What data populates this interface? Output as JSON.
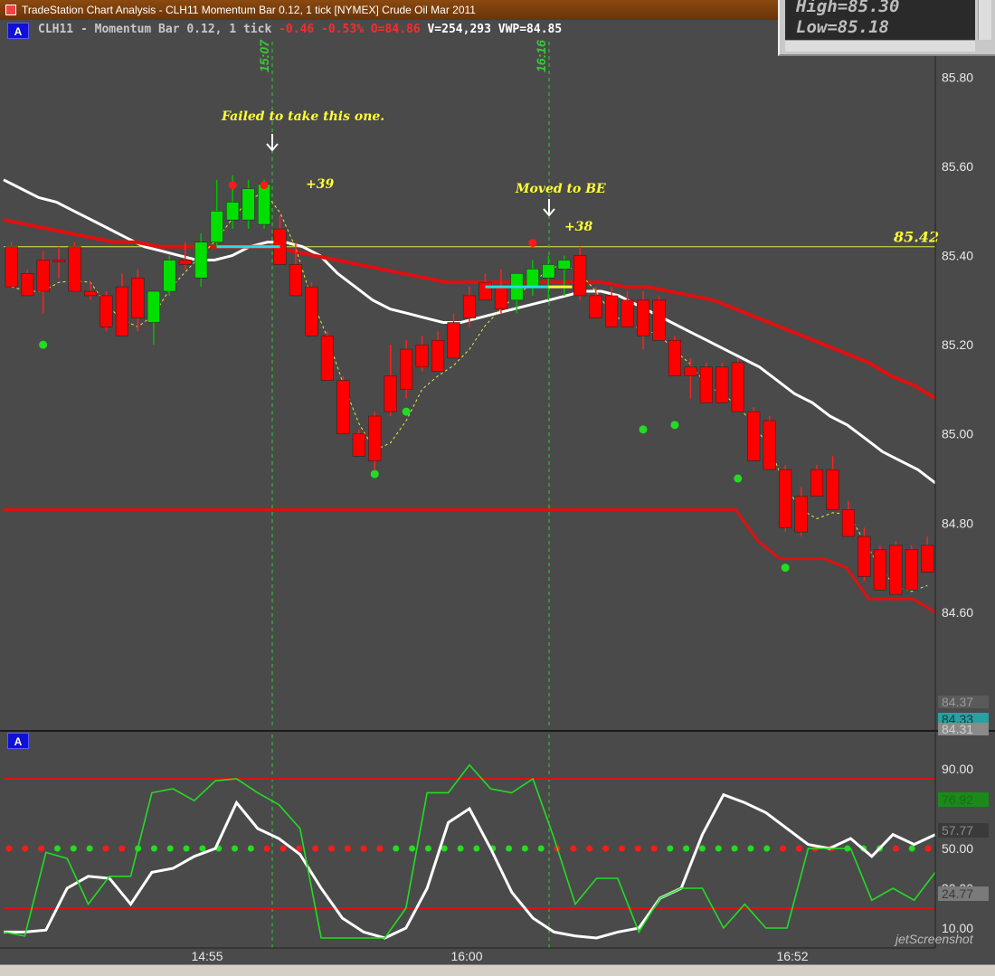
{
  "window": {
    "title": "TradeStation Chart Analysis - CLH11 Momentum Bar 0.12, 1 tick [NYMEX] Crude Oil Mar 2011"
  },
  "info_box": {
    "high": "High=85.30",
    "low": "Low=85.18"
  },
  "price_header": {
    "badge": "A",
    "symbol": "CLH11 - Momentum Bar 0.12, 1 tick",
    "change": "-0.46 -0.53% O=84.86",
    "volume": "V=254,293 VWP=84.85"
  },
  "indicator_header": {
    "badge": "A"
  },
  "price_axis": {
    "ticks": [
      "85.80",
      "85.60",
      "85.40",
      "85.20",
      "85.00",
      "84.80",
      "84.60",
      "84.40"
    ],
    "current_label": "85.42",
    "side_labels": [
      {
        "text": "84.37",
        "bg": "#5a5a5a",
        "fg": "#9a9a9a"
      },
      {
        "text": "84.33",
        "bg": "#2aa0a0",
        "fg": "#1a3a3a"
      },
      {
        "text": "84.31",
        "bg": "#8a8a8a",
        "fg": "#d0d0d0"
      }
    ]
  },
  "indicator_axis": {
    "ticks": [
      "90.00",
      "50.00",
      "30.00",
      "10.00"
    ],
    "side_labels": [
      {
        "text": "76.92",
        "bg": "#1a8a1a",
        "fg": "#1a6a1a"
      },
      {
        "text": "57.77",
        "bg": "#3a3a3a",
        "fg": "#8a8a8a"
      },
      {
        "text": "24.77",
        "bg": "#7a7a7a",
        "fg": "#3a3a3a"
      }
    ]
  },
  "time_axis": [
    "14:55",
    "16:00",
    "16:52"
  ],
  "vertical_markers": [
    "15:07",
    "16:16"
  ],
  "annotations": {
    "failed": "Failed to take this one.",
    "plus39": "+39",
    "moved": "Moved to BE",
    "plus38": "+38"
  },
  "colors": {
    "background": "#4a4a4a",
    "up_bar": "#00e000",
    "down_bar": "#ff0000",
    "ma_fast": "#ffffff",
    "ma_slow": "#e01010",
    "annotation": "#ffff33"
  },
  "chart_data": [
    {
      "type": "candlestick",
      "x_axis_labels": [
        "14:55",
        "16:00",
        "16:52"
      ],
      "ylim": [
        84.34,
        85.88
      ],
      "reference_line": 85.42,
      "candles": [
        {
          "o": 85.42,
          "h": 85.43,
          "l": 85.33,
          "c": 85.33,
          "up": false
        },
        {
          "o": 85.36,
          "h": 85.37,
          "l": 85.31,
          "c": 85.31,
          "up": false
        },
        {
          "o": 85.39,
          "h": 85.41,
          "l": 85.27,
          "c": 85.32,
          "up": false
        },
        {
          "o": 85.39,
          "h": 85.42,
          "l": 85.35,
          "c": 85.39,
          "up": false
        },
        {
          "o": 85.42,
          "h": 85.43,
          "l": 85.32,
          "c": 85.32,
          "up": false
        },
        {
          "o": 85.32,
          "h": 85.34,
          "l": 85.3,
          "c": 85.31,
          "up": false
        },
        {
          "o": 85.31,
          "h": 85.32,
          "l": 85.23,
          "c": 85.24,
          "up": false
        },
        {
          "o": 85.33,
          "h": 85.36,
          "l": 85.22,
          "c": 85.22,
          "up": false
        },
        {
          "o": 85.35,
          "h": 85.37,
          "l": 85.23,
          "c": 85.26,
          "up": false
        },
        {
          "o": 85.25,
          "h": 85.32,
          "l": 85.2,
          "c": 85.32,
          "up": true
        },
        {
          "o": 85.32,
          "h": 85.4,
          "l": 85.31,
          "c": 85.39,
          "up": true
        },
        {
          "o": 85.39,
          "h": 85.43,
          "l": 85.37,
          "c": 85.38,
          "up": false
        },
        {
          "o": 85.35,
          "h": 85.45,
          "l": 85.33,
          "c": 85.43,
          "up": true
        },
        {
          "o": 85.43,
          "h": 85.57,
          "l": 85.42,
          "c": 85.5,
          "up": true
        },
        {
          "o": 85.48,
          "h": 85.58,
          "l": 85.46,
          "c": 85.52,
          "up": true
        },
        {
          "o": 85.48,
          "h": 85.57,
          "l": 85.46,
          "c": 85.55,
          "up": true
        },
        {
          "o": 85.47,
          "h": 85.57,
          "l": 85.46,
          "c": 85.56,
          "up": true
        },
        {
          "o": 85.46,
          "h": 85.49,
          "l": 85.38,
          "c": 85.38,
          "up": false
        },
        {
          "o": 85.38,
          "h": 85.43,
          "l": 85.31,
          "c": 85.31,
          "up": false
        },
        {
          "o": 85.33,
          "h": 85.34,
          "l": 85.22,
          "c": 85.22,
          "up": false
        },
        {
          "o": 85.22,
          "h": 85.23,
          "l": 85.12,
          "c": 85.12,
          "up": false
        },
        {
          "o": 85.12,
          "h": 85.13,
          "l": 85.0,
          "c": 85.0,
          "up": false
        },
        {
          "o": 85.0,
          "h": 85.01,
          "l": 84.95,
          "c": 84.95,
          "up": false
        },
        {
          "o": 85.04,
          "h": 85.05,
          "l": 84.92,
          "c": 84.94,
          "up": false
        },
        {
          "o": 85.13,
          "h": 85.2,
          "l": 85.04,
          "c": 85.05,
          "up": false
        },
        {
          "o": 85.19,
          "h": 85.21,
          "l": 85.08,
          "c": 85.1,
          "up": false
        },
        {
          "o": 85.2,
          "h": 85.22,
          "l": 85.14,
          "c": 85.15,
          "up": false
        },
        {
          "o": 85.21,
          "h": 85.23,
          "l": 85.14,
          "c": 85.14,
          "up": false
        },
        {
          "o": 85.25,
          "h": 85.27,
          "l": 85.17,
          "c": 85.17,
          "up": false
        },
        {
          "o": 85.31,
          "h": 85.33,
          "l": 85.24,
          "c": 85.26,
          "up": false
        },
        {
          "o": 85.34,
          "h": 85.36,
          "l": 85.3,
          "c": 85.3,
          "up": false
        },
        {
          "o": 85.33,
          "h": 85.37,
          "l": 85.27,
          "c": 85.28,
          "up": false
        },
        {
          "o": 85.3,
          "h": 85.36,
          "l": 85.27,
          "c": 85.36,
          "up": true
        },
        {
          "o": 85.33,
          "h": 85.39,
          "l": 85.31,
          "c": 85.37,
          "up": true
        },
        {
          "o": 85.35,
          "h": 85.4,
          "l": 85.3,
          "c": 85.38,
          "up": true
        },
        {
          "o": 85.37,
          "h": 85.4,
          "l": 85.31,
          "c": 85.39,
          "up": true
        },
        {
          "o": 85.4,
          "h": 85.42,
          "l": 85.3,
          "c": 85.31,
          "up": false
        },
        {
          "o": 85.31,
          "h": 85.33,
          "l": 85.26,
          "c": 85.26,
          "up": false
        },
        {
          "o": 85.31,
          "h": 85.33,
          "l": 85.24,
          "c": 85.24,
          "up": false
        },
        {
          "o": 85.3,
          "h": 85.32,
          "l": 85.24,
          "c": 85.24,
          "up": false
        },
        {
          "o": 85.3,
          "h": 85.32,
          "l": 85.19,
          "c": 85.22,
          "up": false
        },
        {
          "o": 85.3,
          "h": 85.31,
          "l": 85.21,
          "c": 85.21,
          "up": false
        },
        {
          "o": 85.21,
          "h": 85.22,
          "l": 85.13,
          "c": 85.13,
          "up": false
        },
        {
          "o": 85.15,
          "h": 85.17,
          "l": 85.08,
          "c": 85.13,
          "up": false
        },
        {
          "o": 85.15,
          "h": 85.16,
          "l": 85.07,
          "c": 85.07,
          "up": false
        },
        {
          "o": 85.15,
          "h": 85.16,
          "l": 85.07,
          "c": 85.07,
          "up": false
        },
        {
          "o": 85.16,
          "h": 85.17,
          "l": 85.05,
          "c": 85.05,
          "up": false
        },
        {
          "o": 85.05,
          "h": 85.06,
          "l": 84.94,
          "c": 84.94,
          "up": false
        },
        {
          "o": 85.03,
          "h": 85.04,
          "l": 84.92,
          "c": 84.92,
          "up": false
        },
        {
          "o": 84.92,
          "h": 84.93,
          "l": 84.78,
          "c": 84.79,
          "up": false
        },
        {
          "o": 84.86,
          "h": 84.88,
          "l": 84.77,
          "c": 84.78,
          "up": false
        },
        {
          "o": 84.92,
          "h": 84.93,
          "l": 84.86,
          "c": 84.86,
          "up": false
        },
        {
          "o": 84.92,
          "h": 84.95,
          "l": 84.83,
          "c": 84.83,
          "up": false
        },
        {
          "o": 84.83,
          "h": 84.85,
          "l": 84.77,
          "c": 84.77,
          "up": false
        },
        {
          "o": 84.77,
          "h": 84.79,
          "l": 84.67,
          "c": 84.68,
          "up": false
        },
        {
          "o": 84.74,
          "h": 84.75,
          "l": 84.65,
          "c": 84.65,
          "up": false
        },
        {
          "o": 84.75,
          "h": 84.76,
          "l": 84.64,
          "c": 84.64,
          "up": false
        },
        {
          "o": 84.74,
          "h": 84.75,
          "l": 84.65,
          "c": 84.65,
          "up": false
        },
        {
          "o": 84.75,
          "h": 84.77,
          "l": 84.69,
          "c": 84.69,
          "up": false
        }
      ],
      "series": [
        {
          "kind": "ma_fast",
          "values": [
            85.57,
            85.55,
            85.53,
            85.52,
            85.5,
            85.48,
            85.46,
            85.44,
            85.42,
            85.41,
            85.4,
            85.39,
            85.39,
            85.4,
            85.42,
            85.43,
            85.43,
            85.42,
            85.4,
            85.36,
            85.33,
            85.3,
            85.28,
            85.27,
            85.26,
            85.25,
            85.25,
            85.26,
            85.27,
            85.28,
            85.29,
            85.3,
            85.31,
            85.32,
            85.32,
            85.31,
            85.29,
            85.27,
            85.25,
            85.23,
            85.21,
            85.19,
            85.17,
            85.15,
            85.12,
            85.09,
            85.07,
            85.04,
            85.02,
            84.99,
            84.96,
            84.94,
            84.92,
            84.89
          ]
        },
        {
          "kind": "ma_slow",
          "values": [
            85.48,
            85.47,
            85.46,
            85.45,
            85.44,
            85.43,
            85.43,
            85.42,
            85.42,
            85.42,
            85.42,
            85.42,
            85.42,
            85.41,
            85.4,
            85.39,
            85.38,
            85.37,
            85.36,
            85.35,
            85.34,
            85.34,
            85.34,
            85.34,
            85.34,
            85.34,
            85.34,
            85.34,
            85.33,
            85.33,
            85.32,
            85.31,
            85.3,
            85.28,
            85.26,
            85.24,
            85.22,
            85.2,
            85.18,
            85.16,
            85.13,
            85.11,
            85.08
          ]
        },
        {
          "kind": "lower_band",
          "values": [
            84.83,
            84.83,
            84.83,
            84.83,
            84.83,
            84.83,
            84.83,
            84.83,
            84.83,
            84.83,
            84.83,
            84.83,
            84.83,
            84.83,
            84.83,
            84.83,
            84.83,
            84.83,
            84.83,
            84.83,
            84.83,
            84.83,
            84.83,
            84.83,
            84.83,
            84.83,
            84.83,
            84.83,
            84.83,
            84.83,
            84.83,
            84.83,
            84.83,
            84.83,
            84.76,
            84.72,
            84.72,
            84.72,
            84.7,
            84.63,
            84.63,
            84.63,
            84.6
          ]
        }
      ]
    },
    {
      "type": "line",
      "ylim": [
        0,
        100
      ],
      "levels": [
        85,
        50,
        20
      ],
      "series": [
        {
          "kind": "fast",
          "values": [
            8,
            8,
            9,
            30,
            36,
            35,
            22,
            38,
            40,
            46,
            50,
            73,
            60,
            55,
            47,
            30,
            15,
            8,
            5,
            10,
            30,
            63,
            70,
            50,
            28,
            15,
            8,
            6,
            5,
            8,
            10,
            25,
            30,
            57,
            77,
            73,
            68,
            60,
            52,
            50,
            55,
            46,
            57,
            52,
            57
          ]
        },
        {
          "kind": "slow",
          "values": [
            8,
            6,
            48,
            45,
            22,
            36,
            36,
            78,
            80,
            74,
            84,
            85,
            78,
            72,
            60,
            5,
            5,
            5,
            5,
            20,
            78,
            78,
            92,
            80,
            78,
            85,
            55,
            22,
            35,
            35,
            8,
            25,
            30,
            30,
            10,
            22,
            10,
            10,
            50,
            50,
            50,
            24,
            30,
            24,
            38
          ]
        }
      ]
    }
  ]
}
